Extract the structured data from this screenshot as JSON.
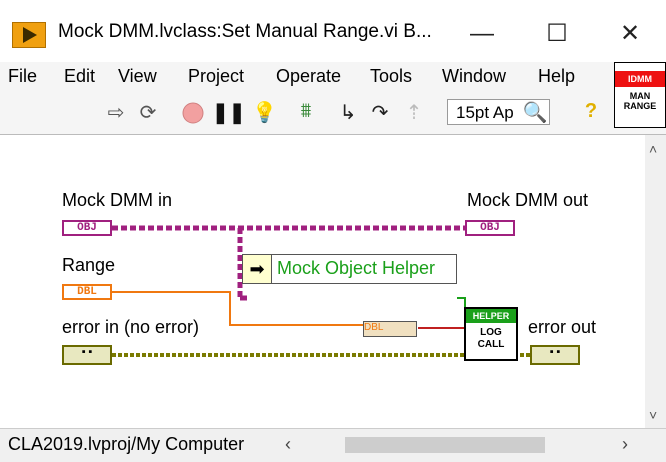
{
  "window": {
    "title": "Mock DMM.lvclass:Set Manual Range.vi B...",
    "minimize_glyph": "—",
    "maximize_glyph": "☐",
    "close_glyph": "✕"
  },
  "menu": [
    "File",
    "Edit",
    "View",
    "Project",
    "Operate",
    "Tools",
    "Window",
    "Help"
  ],
  "toolbar": {
    "font_select": "15pt Ap",
    "icons": [
      "run-arrow-icon",
      "run-continuously-icon",
      "abort-icon",
      "pause-icon",
      "highlight-bulb-icon",
      "retain-wire-values-icon",
      "step-into-icon",
      "step-over-icon",
      "step-out-icon",
      "search-icon",
      "help-icon"
    ]
  },
  "vi_icon": {
    "top": "IDMM",
    "text": "MAN RANGE"
  },
  "diagram": {
    "terminals": {
      "mock_dmm_in": {
        "label": "Mock DMM in",
        "type": "OBJ"
      },
      "mock_dmm_out": {
        "label": "Mock DMM out",
        "type": "OBJ"
      },
      "range": {
        "label": "Range",
        "type": "DBL"
      },
      "error_in": {
        "label": "error in (no error)",
        "type": "▪▪"
      },
      "error_out": {
        "label": "error out",
        "type": "▪▪"
      }
    },
    "helper": {
      "label": "Mock Object Helper",
      "arrow": "➡"
    },
    "logcall": {
      "top": "HELPER",
      "text": "LOG CALL"
    },
    "unbundle": "DBL"
  },
  "status": {
    "path": "CLA2019.lvproj/My Computer"
  },
  "colors": {
    "class_wire": "#a0207f",
    "dbl_wire": "#f07810",
    "error_wire": "#7a7a00",
    "helper_text": "#1aa01a"
  }
}
